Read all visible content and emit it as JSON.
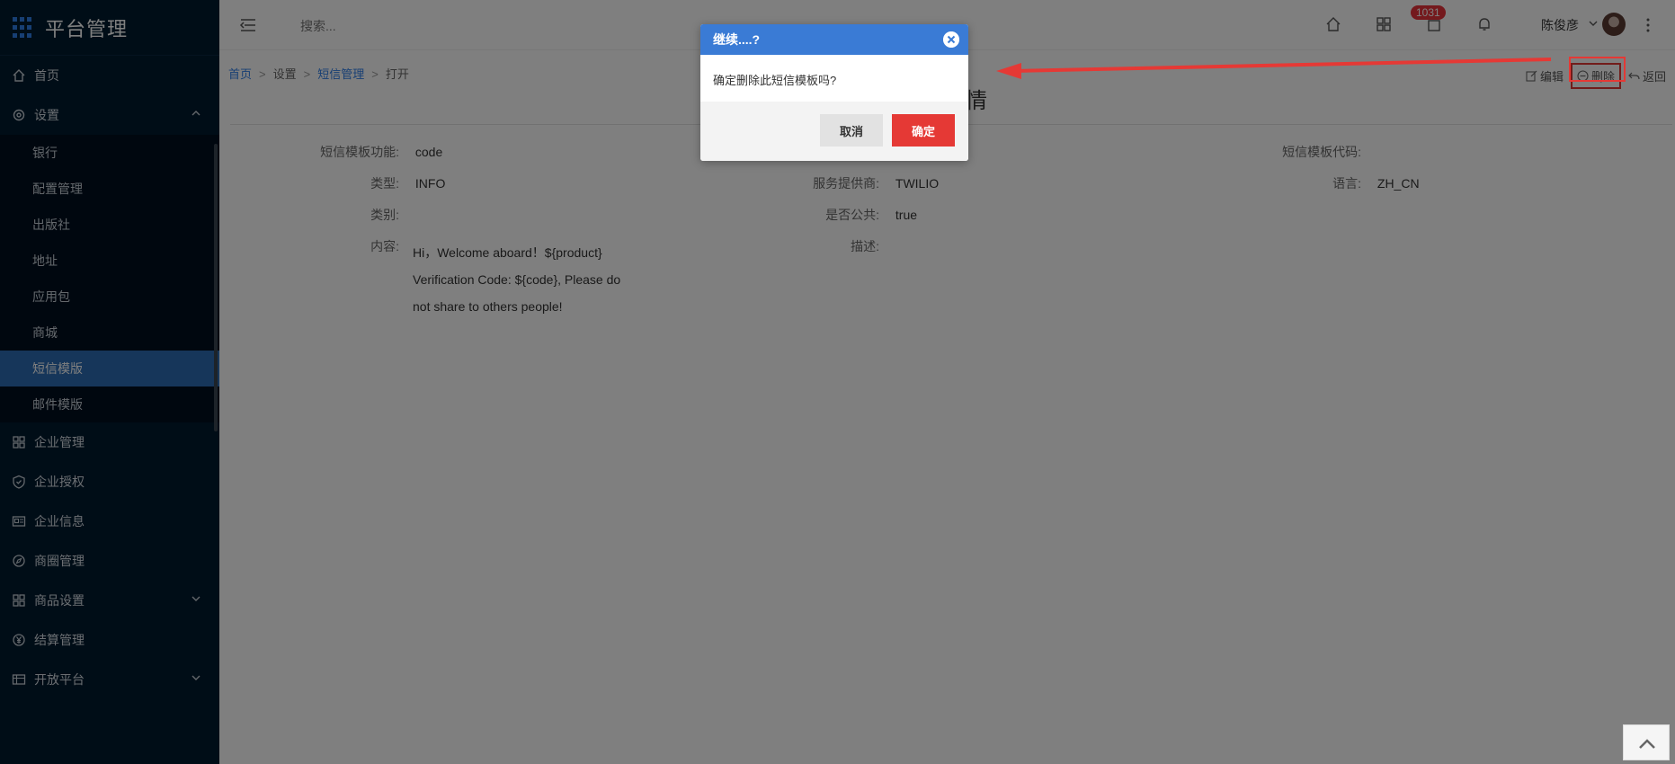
{
  "brand": {
    "title": "平台管理"
  },
  "sidebar": {
    "items": [
      {
        "label": "首页",
        "icon": "home-icon"
      },
      {
        "label": "设置",
        "icon": "gear-icon",
        "expanded": true
      },
      {
        "label": "企业管理",
        "icon": "building-icon"
      },
      {
        "label": "企业授权",
        "icon": "shield-icon"
      },
      {
        "label": "企业信息",
        "icon": "id-card-icon"
      },
      {
        "label": "商圈管理",
        "icon": "compass-icon"
      },
      {
        "label": "商品设置",
        "icon": "grid-icon"
      },
      {
        "label": "结算管理",
        "icon": "yen-icon"
      },
      {
        "label": "开放平台",
        "icon": "table-icon"
      }
    ],
    "subitems": [
      "银行",
      "配置管理",
      "出版社",
      "地址",
      "应用包",
      "商城",
      "短信模版",
      "邮件模版"
    ],
    "active_sub": "短信模版"
  },
  "topbar": {
    "search_placeholder": "搜索...",
    "badge_count": "1031",
    "username": "陈俊彦"
  },
  "breadcrumb": {
    "home": "首页",
    "settings": "设置",
    "sms": "短信管理",
    "current": "打开",
    "sep": ">"
  },
  "page": {
    "title_partial": "情",
    "actions": {
      "edit": "编辑",
      "delete": "删除",
      "back": "返回"
    }
  },
  "fields": {
    "function_label": "短信模板功能:",
    "function_value": "code",
    "code_label": "短信模板代码:",
    "code_value": "",
    "type_label": "类型:",
    "type_value": "INFO",
    "provider_label": "服务提供商:",
    "provider_value": "TWILIO",
    "lang_label": "语言:",
    "lang_value": "ZH_CN",
    "category_label": "类别:",
    "category_value": "",
    "public_label": "是否公共:",
    "public_value": "true",
    "content_label": "内容:",
    "content_value": "Hi，Welcome aboard！${product} Verification Code: ${code}, Please do not share to others people!",
    "desc_label": "描述:",
    "desc_value": ""
  },
  "dialog": {
    "title": "继续....?",
    "message": "确定删除此短信模板吗?",
    "cancel": "取消",
    "confirm": "确定"
  },
  "colors": {
    "sidebar_bg": "#001a2e",
    "active": "#2c6db5",
    "dialog_header": "#3a7bd5",
    "danger": "#e53935"
  }
}
